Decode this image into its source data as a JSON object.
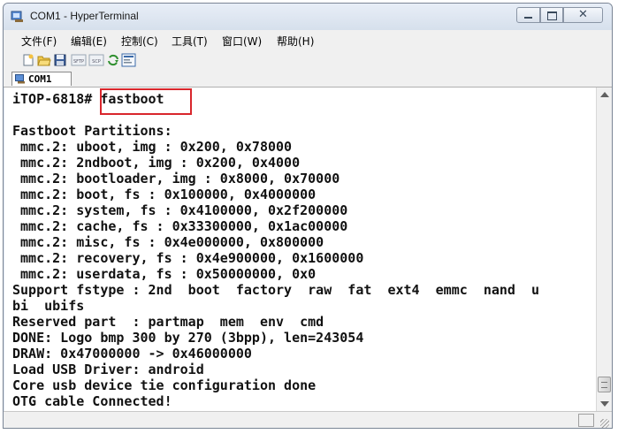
{
  "window": {
    "title": "COM1 - HyperTerminal"
  },
  "menu": {
    "items": [
      "文件(F)",
      "编辑(E)",
      "控制(C)",
      "工具(T)",
      "窗口(W)",
      "帮助(H)"
    ]
  },
  "toolbar": {
    "icons": [
      "new-icon",
      "open-icon",
      "save-icon",
      "sftp-icon",
      "scp-icon",
      "refresh-icon",
      "properties-icon"
    ],
    "sftp_label": "SFTP",
    "scp_label": "SCP"
  },
  "tabs": {
    "active": "COM1"
  },
  "terminal": {
    "lines": [
      "iTOP-6818# fastboot",
      "",
      "Fastboot Partitions:",
      " mmc.2: uboot, img : 0x200, 0x78000",
      " mmc.2: 2ndboot, img : 0x200, 0x4000",
      " mmc.2: bootloader, img : 0x8000, 0x70000",
      " mmc.2: boot, fs : 0x100000, 0x4000000",
      " mmc.2: system, fs : 0x4100000, 0x2f200000",
      " mmc.2: cache, fs : 0x33300000, 0x1ac00000",
      " mmc.2: misc, fs : 0x4e000000, 0x800000",
      " mmc.2: recovery, fs : 0x4e900000, 0x1600000",
      " mmc.2: userdata, fs : 0x50000000, 0x0",
      "Support fstype : 2nd  boot  factory  raw  fat  ext4  emmc  nand  u",
      "bi  ubifs",
      "Reserved part  : partmap  mem  env  cmd",
      "DONE: Logo bmp 300 by 270 (3bpp), len=243054",
      "DRAW: 0x47000000 -> 0x46000000",
      "Load USB Driver: android",
      "Core usb device tie configuration done",
      "OTG cable Connected!"
    ],
    "highlight_color": "#d9262c"
  }
}
